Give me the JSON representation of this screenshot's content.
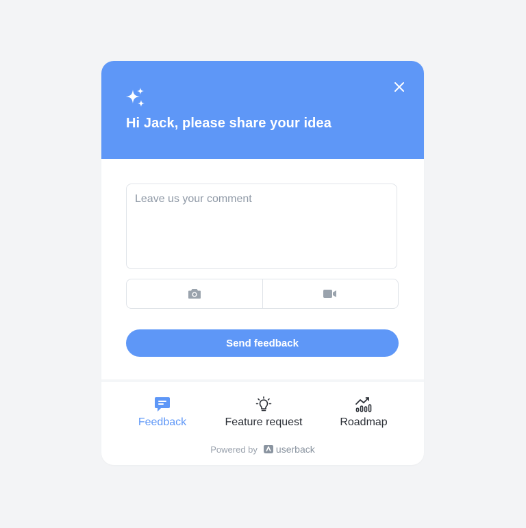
{
  "header": {
    "title": "Hi Jack, please share your idea",
    "sparkle_icon": "sparkle-icon",
    "close_icon": "close-icon"
  },
  "form": {
    "comment_placeholder": "Leave us your comment",
    "comment_value": "",
    "screenshot_icon": "camera-icon",
    "video_icon": "video-camera-icon",
    "submit_label": "Send feedback"
  },
  "nav": {
    "items": [
      {
        "label": "Feedback",
        "icon": "chat-bubble-icon",
        "active": true
      },
      {
        "label": "Feature request",
        "icon": "lightbulb-icon",
        "active": false
      },
      {
        "label": "Roadmap",
        "icon": "chart-icon",
        "active": false
      }
    ]
  },
  "footer": {
    "powered_by": "Powered by",
    "brand": "userback",
    "brand_icon": "userback-logo-icon"
  },
  "colors": {
    "accent": "#5e97f7",
    "background": "#f3f4f6",
    "border": "#dfe3e8",
    "muted_icon": "#9aa3ad"
  }
}
